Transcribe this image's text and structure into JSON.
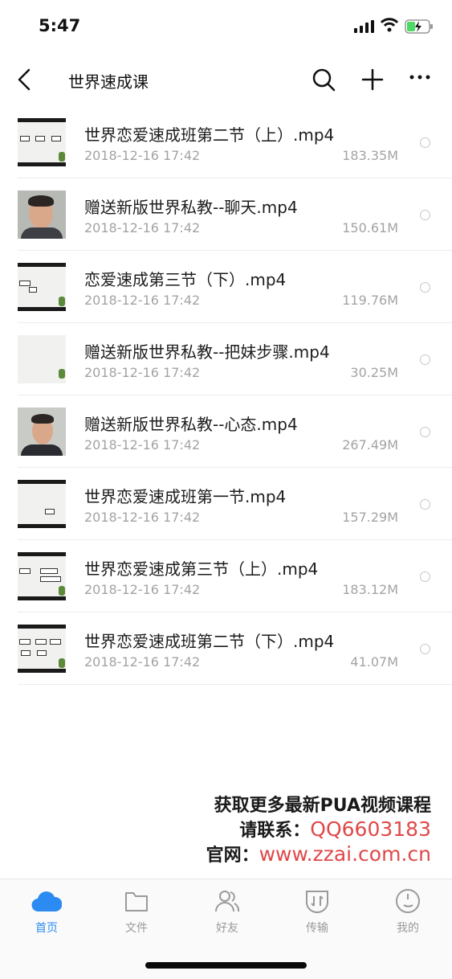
{
  "status": {
    "time": "5:47"
  },
  "nav": {
    "title": "世界速成课"
  },
  "files": [
    {
      "name": "世界恋爱速成班第二节（上）.mp4",
      "date": "2018-12-16 17:42",
      "size": "183.35M",
      "thumb": "slide"
    },
    {
      "name": "赠送新版世界私教--聊天.mp4",
      "date": "2018-12-16 17:42",
      "size": "150.61M",
      "thumb": "face"
    },
    {
      "name": "恋爱速成第三节（下）.mp4",
      "date": "2018-12-16 17:42",
      "size": "119.76M",
      "thumb": "slide"
    },
    {
      "name": "赠送新版世界私教--把妹步骤.mp4",
      "date": "2018-12-16 17:42",
      "size": "30.25M",
      "thumb": "slide"
    },
    {
      "name": "赠送新版世界私教--心态.mp4",
      "date": "2018-12-16 17:42",
      "size": "267.49M",
      "thumb": "face"
    },
    {
      "name": "世界恋爱速成班第一节.mp4",
      "date": "2018-12-16 17:42",
      "size": "157.29M",
      "thumb": "slide"
    },
    {
      "name": "世界恋爱速成第三节（上）.mp4",
      "date": "2018-12-16 17:42",
      "size": "183.12M",
      "thumb": "slide"
    },
    {
      "name": "世界恋爱速成班第二节（下）.mp4",
      "date": "2018-12-16 17:42",
      "size": "41.07M",
      "thumb": "slide"
    }
  ],
  "promo": {
    "line1": "获取更多最新PUA视频课程",
    "line2_label": "请联系：",
    "line2_value": "QQ6603183",
    "line3_label": "官网：",
    "line3_value": "www.zzai.com.cn"
  },
  "tabs": [
    {
      "label": "首页",
      "icon": "cloud-icon",
      "active": true
    },
    {
      "label": "文件",
      "icon": "folder-icon",
      "active": false
    },
    {
      "label": "好友",
      "icon": "friends-icon",
      "active": false
    },
    {
      "label": "传输",
      "icon": "transfer-icon",
      "active": false
    },
    {
      "label": "我的",
      "icon": "profile-icon",
      "active": false
    }
  ],
  "colors": {
    "accent": "#2b8bf2",
    "promo_red": "#e04848"
  }
}
